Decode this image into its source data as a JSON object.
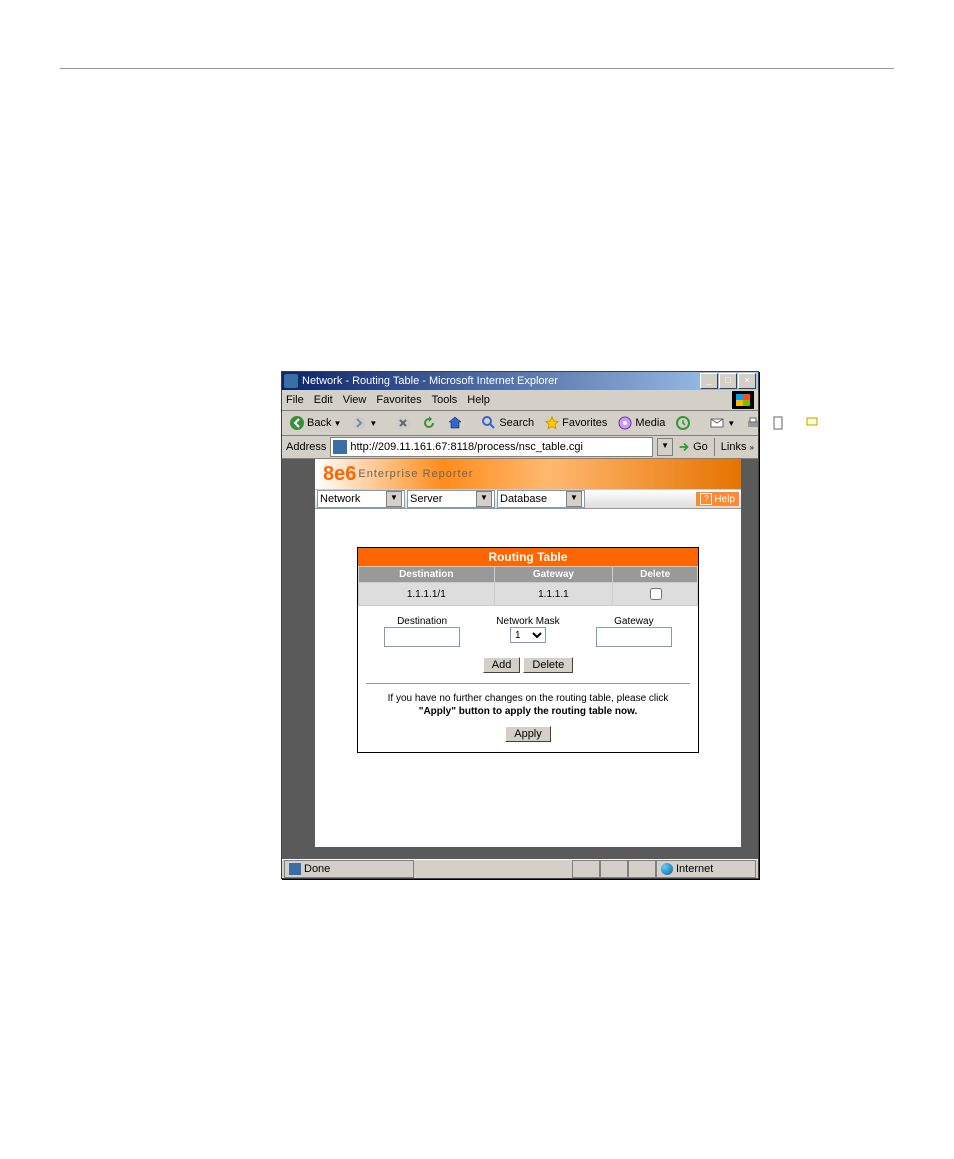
{
  "window": {
    "title": "Network - Routing Table - Microsoft Internet Explorer"
  },
  "menu": {
    "items": [
      "File",
      "Edit",
      "View",
      "Favorites",
      "Tools",
      "Help"
    ]
  },
  "toolbar": {
    "back": "Back",
    "search": "Search",
    "favorites": "Favorites",
    "media": "Media"
  },
  "address": {
    "label": "Address",
    "url": "http://209.11.161.67:8118/process/nsc_table.cgi",
    "go": "Go",
    "links": "Links"
  },
  "banner": {
    "logo": "8e6",
    "product": "Enterprise Reporter"
  },
  "nav": {
    "menu1": "Network",
    "menu2": "Server",
    "menu3": "Database",
    "help": "Help"
  },
  "panel": {
    "title": "Routing Table",
    "cols": {
      "dest": "Destination",
      "gw": "Gateway",
      "del": "Delete"
    },
    "rows": [
      {
        "dest": "1.1.1.1/1",
        "gw": "1.1.1.1",
        "del": false
      }
    ],
    "form": {
      "destLabel": "Destination",
      "maskLabel": "Network Mask",
      "gwLabel": "Gateway",
      "maskVal": "1"
    },
    "btns": {
      "add": "Add",
      "delete": "Delete",
      "apply": "Apply"
    },
    "note1": "If you have no further changes on the routing table, please click",
    "note2": "\"Apply\" button to apply the routing table now."
  },
  "status": {
    "done": "Done",
    "zone": "Internet"
  }
}
